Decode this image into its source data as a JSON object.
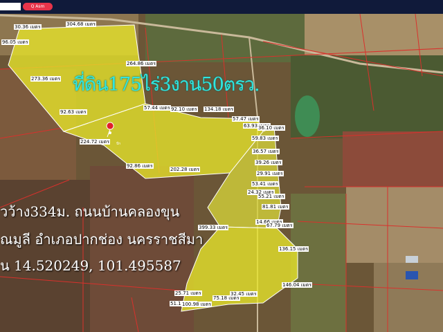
{
  "topbar": {
    "search_placeholder": "",
    "search_button": "Q Asm"
  },
  "title_text": "ที่ดิน175ไร่3งาน50ตรว.",
  "address_lines": [
    "วว้าง334ม. ถนนบ้านคลองขุน",
    "ณมูลี อำเภอปากช่อง นครราชสีมา",
    "น 14.520249, 101.495587"
  ],
  "pin_label": "ปัก",
  "measurements": [
    {
      "id": "m1",
      "text": "30.36 เมตร"
    },
    {
      "id": "m2",
      "text": "304.68 เมตร"
    },
    {
      "id": "m3",
      "text": "96.05 เมตร"
    },
    {
      "id": "m4",
      "text": "264.86 เมตร"
    },
    {
      "id": "m5",
      "text": "273.36 เมตร"
    },
    {
      "id": "m6",
      "text": "92.63 เมตร"
    },
    {
      "id": "m7",
      "text": "57.44 เมตร"
    },
    {
      "id": "m8",
      "text": "92.10 เมตร"
    },
    {
      "id": "m9",
      "text": "134.18 เมตร"
    },
    {
      "id": "m10",
      "text": "57.47 เมตร"
    },
    {
      "id": "m11",
      "text": "63.93 เมตร"
    },
    {
      "id": "m12",
      "text": "36.10 เมตร"
    },
    {
      "id": "m13",
      "text": "224.72 เมตร"
    },
    {
      "id": "m14",
      "text": "59.83 เมตร"
    },
    {
      "id": "m15",
      "text": "36.57 เมตร"
    },
    {
      "id": "m16",
      "text": "39.26 เมตร"
    },
    {
      "id": "m17",
      "text": "92.86 เมตร"
    },
    {
      "id": "m18",
      "text": "202.28 เมตร"
    },
    {
      "id": "m19",
      "text": "29.91 เมตร"
    },
    {
      "id": "m20",
      "text": "53.41 เมตร"
    },
    {
      "id": "m21",
      "text": "24.32 เมตร"
    },
    {
      "id": "m22",
      "text": "55.21 เมตร"
    },
    {
      "id": "m23",
      "text": "81.81 เมตร"
    },
    {
      "id": "m24",
      "text": "14.66 เมตร"
    },
    {
      "id": "m25",
      "text": "67.79 เมตร"
    },
    {
      "id": "m26",
      "text": "399.33 เมตร"
    },
    {
      "id": "m27",
      "text": "136.15 เมตร"
    },
    {
      "id": "m28",
      "text": "146.04 เมตร"
    },
    {
      "id": "m29",
      "text": "25.71 เมตร"
    },
    {
      "id": "m30",
      "text": "32.45 เมตร"
    },
    {
      "id": "m31",
      "text": "75.18 เมตร"
    },
    {
      "id": "m32",
      "text": "51.10 เมตร"
    },
    {
      "id": "m33",
      "text": "100.98 เมตร"
    }
  ],
  "colors": {
    "parcel_fill": "#e8e62a",
    "parcel_border": "#ffffff",
    "boundary_lines": "#d9312c",
    "title": "#2fe6e0",
    "topbar": "#101a3a",
    "search_button": "#e8344a",
    "pin": "#e0202a"
  }
}
